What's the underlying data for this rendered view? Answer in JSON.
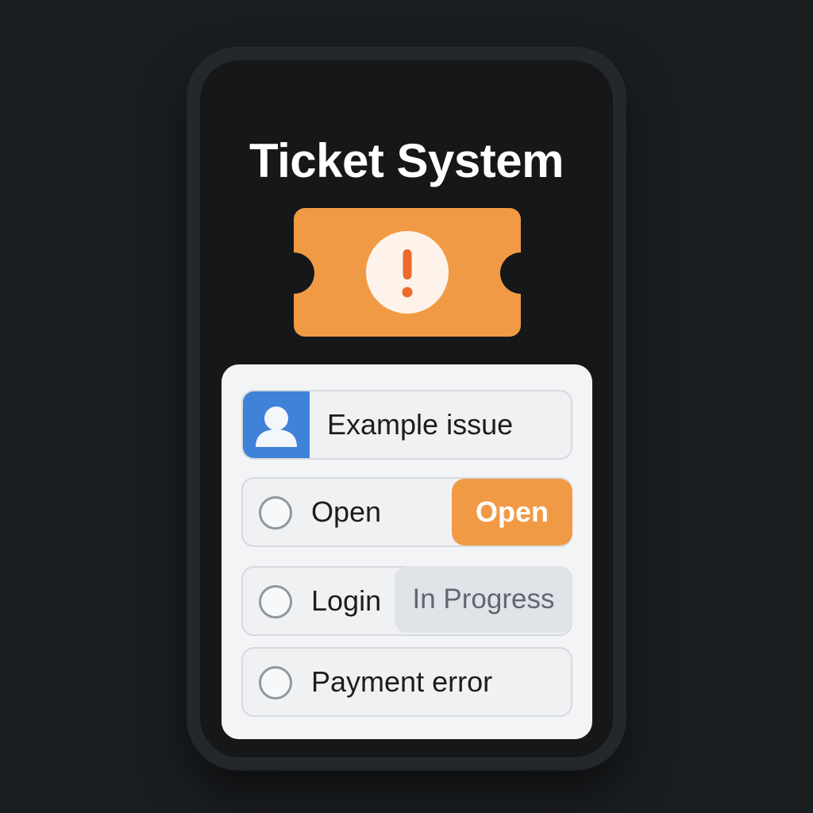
{
  "app": {
    "title": "Ticket System"
  },
  "ticket_icon": {
    "icon": "ticket-alert-icon",
    "color": "#f19a45"
  },
  "issue": {
    "avatar_icon": "user-avatar-icon",
    "text": "Example issue"
  },
  "tickets": [
    {
      "label": "Open",
      "badge": "Open",
      "badge_style": "orange"
    },
    {
      "label": "Login",
      "badge": "In Progress",
      "badge_style": "gray"
    },
    {
      "label": "Payment error"
    }
  ],
  "colors": {
    "background": "#1b1e21",
    "accent": "#f19a45",
    "avatar": "#3f82d8"
  }
}
